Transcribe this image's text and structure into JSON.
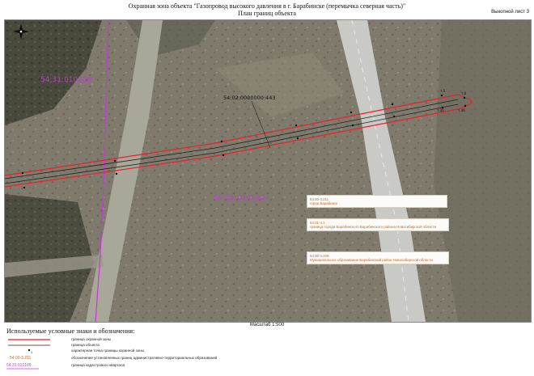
{
  "header": {
    "title_line1": "Охранная зона объекта \"Газопровод высокого давления в г. Барабинске (перемычка северная часть)\"",
    "title_line2": "План границ объекта",
    "sheet_label": "Выкопной лист 3"
  },
  "map_labels": {
    "quarter_left": "54:31:010109",
    "quarter_center": "54:31:010112",
    "parcel": "54:02:0000000:443",
    "point_labels": [
      "т.5",
      "т.6",
      "т.35",
      "т.36"
    ]
  },
  "info_boxes": [
    {
      "code": "54:00-3.211",
      "text": "город Барабинск"
    },
    {
      "code": "54:31-4.1",
      "text": "граница города Барабинского Барабинского района Новосибирской области"
    },
    {
      "code": "54:00-3.208",
      "text": "Муниципальное образование Барабинский район Новосибирской области"
    }
  ],
  "scale": {
    "label": "Масштаб 1:500"
  },
  "legend": {
    "title": "Используемые условные знаки и обозначения:",
    "items": [
      {
        "symbol": "red-line",
        "label": "граница охранной зоны"
      },
      {
        "symbol": "black-line",
        "label": "граница объекта"
      },
      {
        "symbol": "point",
        "symbol_text": "1",
        "label": "характерная точка границы охранной зоны"
      },
      {
        "symbol": "text-orange",
        "symbol_text": "54:00-3.211",
        "label": "обозначение установленных границ административно-территориальных образований"
      },
      {
        "symbol": "text-magenta",
        "symbol_text": "54:31:010109",
        "label": "граница кадастрового квартала"
      }
    ]
  },
  "colors": {
    "zone_boundary": "#e8202a",
    "object_boundary": "#202020",
    "cadastral": "#c23bd4",
    "admin_text": "#c06a28"
  }
}
